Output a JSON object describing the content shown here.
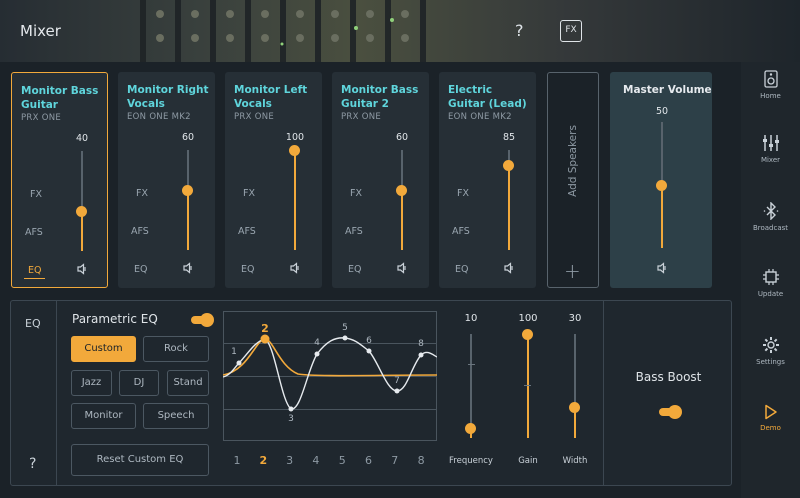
{
  "header": {
    "title": "Mixer",
    "help": "?",
    "fx": "FX"
  },
  "sidebar": {
    "items": [
      {
        "label": "Home",
        "icon": "speaker-icon"
      },
      {
        "label": "Mixer",
        "icon": "sliders-icon"
      },
      {
        "label": "Broadcast",
        "icon": "bluetooth-broadcast-icon"
      },
      {
        "label": "Update",
        "icon": "chip-icon"
      },
      {
        "label": "Settings",
        "icon": "gear-icon"
      },
      {
        "label": "Demo",
        "icon": "play-icon",
        "active": true
      }
    ]
  },
  "channels": [
    {
      "name": "Monitor Bass Guitar",
      "model": "PRX ONE",
      "value": 40,
      "level": 0.4,
      "fx": "FX",
      "afs": "AFS",
      "eq": "EQ",
      "selected": true
    },
    {
      "name": "Monitor Right Vocals",
      "model": "EON ONE MK2",
      "value": 60,
      "level": 0.6,
      "fx": "FX",
      "afs": "AFS",
      "eq": "EQ"
    },
    {
      "name": "Monitor Left Vocals",
      "model": "PRX ONE",
      "value": 100,
      "level": 1.0,
      "fx": "FX",
      "afs": "AFS",
      "eq": "EQ"
    },
    {
      "name": "Monitor Bass Guitar 2",
      "model": "PRX ONE",
      "value": 60,
      "level": 0.6,
      "fx": "FX",
      "afs": "AFS",
      "eq": "EQ"
    },
    {
      "name": "Electric Guitar (Lead)",
      "model": "EON ONE MK2",
      "value": 85,
      "level": 0.85,
      "fx": "FX",
      "afs": "AFS",
      "eq": "EQ"
    }
  ],
  "add_speakers": {
    "label": "Add Speakers",
    "plus": "+"
  },
  "master": {
    "title": "Master Volume",
    "value": 50,
    "level": 0.5
  },
  "eq": {
    "tab": "EQ",
    "help": "?",
    "title": "Parametric EQ",
    "enabled": true,
    "presets": [
      {
        "label": "Custom",
        "active": true
      },
      {
        "label": "Rock"
      },
      {
        "label": "Jazz"
      },
      {
        "label": "DJ"
      },
      {
        "label": "Stand"
      },
      {
        "label": "Monitor"
      },
      {
        "label": "Speech"
      }
    ],
    "reset": "Reset Custom EQ",
    "bands": [
      "1",
      "2",
      "3",
      "4",
      "5",
      "6",
      "7",
      "8"
    ],
    "selected_band": "2",
    "band_labels": [
      "1",
      "2",
      "3",
      "4",
      "5",
      "6",
      "7",
      "8"
    ],
    "frequency": {
      "label": "Frequency",
      "value": 10,
      "level": 0.1
    },
    "gain": {
      "label": "Gain",
      "value": 100,
      "level": 1.0
    },
    "width": {
      "label": "Width",
      "value": 30,
      "level": 0.3
    }
  },
  "bass_boost": {
    "label": "Bass Boost",
    "enabled": true
  },
  "colors": {
    "accent": "#f2a93b",
    "name": "#5fd5dc",
    "bg": "#1b2228",
    "card": "#262f36",
    "master": "#2d4048"
  }
}
